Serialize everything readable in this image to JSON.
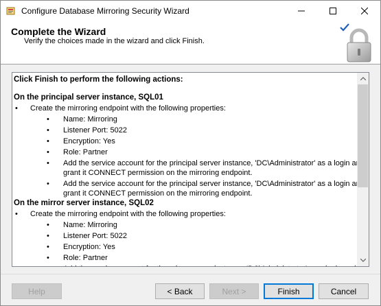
{
  "window": {
    "title": "Configure Database Mirroring Security Wizard"
  },
  "header": {
    "title": "Complete the Wizard",
    "subtitle": "Verify the choices made in the wizard and click Finish."
  },
  "content": {
    "lines": [
      {
        "text": "Click Finish to perform the following actions:",
        "style": "bold",
        "indent": 0
      },
      {
        "text": "On the principal server instance, SQL01",
        "style": "bold",
        "indent": 0
      },
      {
        "text": "Create the mirroring endpoint with the following properties:",
        "style": "bullet1",
        "indent": 1
      },
      {
        "text": "Name: Mirroring",
        "style": "bullet2",
        "indent": 2
      },
      {
        "text": "Listener Port: 5022",
        "style": "bullet2",
        "indent": 2
      },
      {
        "text": "Encryption: Yes",
        "style": "bullet2",
        "indent": 2
      },
      {
        "text": "Role: Partner",
        "style": "bullet2",
        "indent": 2
      },
      {
        "text": "Add the service account for the principal server instance, 'DC\\Administrator' as a login and",
        "style": "bullet2",
        "indent": 2
      },
      {
        "text": "grant it CONNECT permission on the mirroring endpoint.",
        "style": "cont",
        "indent": 2
      },
      {
        "text": "Add the service account for the principal server instance, 'DC\\Administrator' as a login and",
        "style": "bullet2",
        "indent": 2
      },
      {
        "text": "grant it CONNECT permission on the mirroring endpoint.",
        "style": "cont",
        "indent": 2
      },
      {
        "text": "On the mirror server instance, SQL02",
        "style": "bold",
        "indent": 0
      },
      {
        "text": "Create the mirroring endpoint with the following properties:",
        "style": "bullet1",
        "indent": 1
      },
      {
        "text": "Name: Mirroring",
        "style": "bullet2",
        "indent": 2
      },
      {
        "text": "Listener Port: 5022",
        "style": "bullet2",
        "indent": 2
      },
      {
        "text": "Encryption: Yes",
        "style": "bullet2",
        "indent": 2
      },
      {
        "text": "Role: Partner",
        "style": "bullet2",
        "indent": 2
      },
      {
        "text": "Add the service account for the mirror server instance, 'DC\\Administrator' as a login and",
        "style": "bullet2",
        "indent": 2
      }
    ]
  },
  "buttons": {
    "help": "Help",
    "back": "< Back",
    "next": "Next >",
    "finish": "Finish",
    "cancel": "Cancel"
  },
  "icons": {
    "app": "wizard-app-icon",
    "check": "checkmark-icon",
    "lock": "padlock-icon"
  },
  "colors": {
    "accent": "#0078d7",
    "check": "#1f5fb8"
  }
}
